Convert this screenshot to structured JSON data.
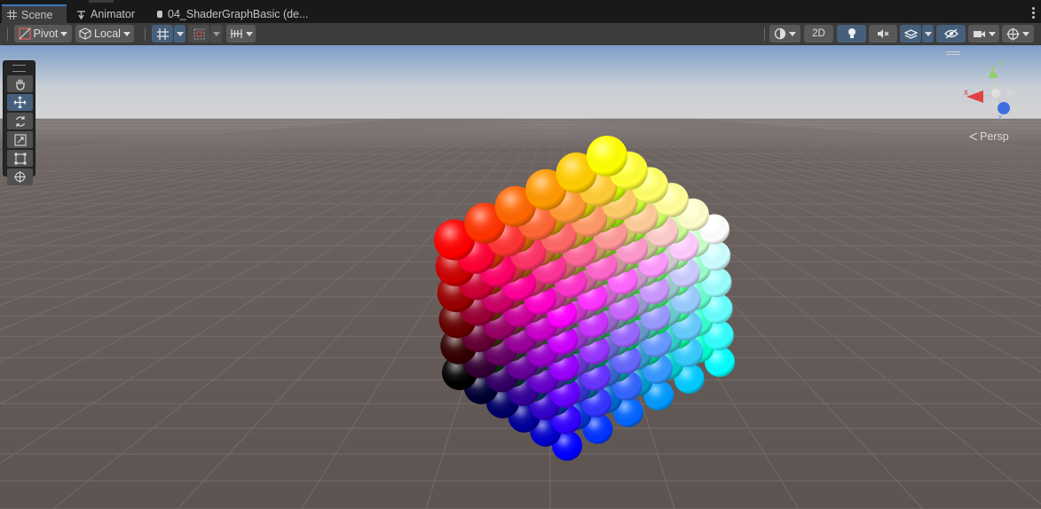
{
  "tabs": {
    "scene": "Scene",
    "animator": "Animator",
    "shader": "04_ShaderGraphBasic (de..."
  },
  "toolbar": {
    "pivot": "Pivot",
    "local": "Local",
    "two_d": "2D"
  },
  "viewport": {
    "projection": "Persp",
    "gizmo_axes": {
      "x": "x",
      "y": "y",
      "z": "z"
    }
  },
  "colors": {
    "accent": "#3a79bb",
    "sky_top": "#7d9dc8",
    "ground": "#635a57"
  },
  "icons": [
    "grid-icon",
    "animator-icon",
    "shadergraph-icon",
    "pivot-icon",
    "local-icon",
    "grid-snap-icon",
    "increment-snap-icon",
    "ruler-icon",
    "shading-mode-icon",
    "lighting-icon",
    "audio-mute-icon",
    "effects-icon",
    "hidden-objects-icon",
    "camera-icon",
    "gizmos-icon",
    "hand-tool-icon",
    "move-tool-icon",
    "rotate-tool-icon",
    "scale-tool-icon",
    "rect-tool-icon",
    "transform-tool-icon",
    "kebab-menu-icon"
  ],
  "scene_objects": {
    "sphere_grid": "6 x 6 x 6 RGB color cube of spheres"
  }
}
